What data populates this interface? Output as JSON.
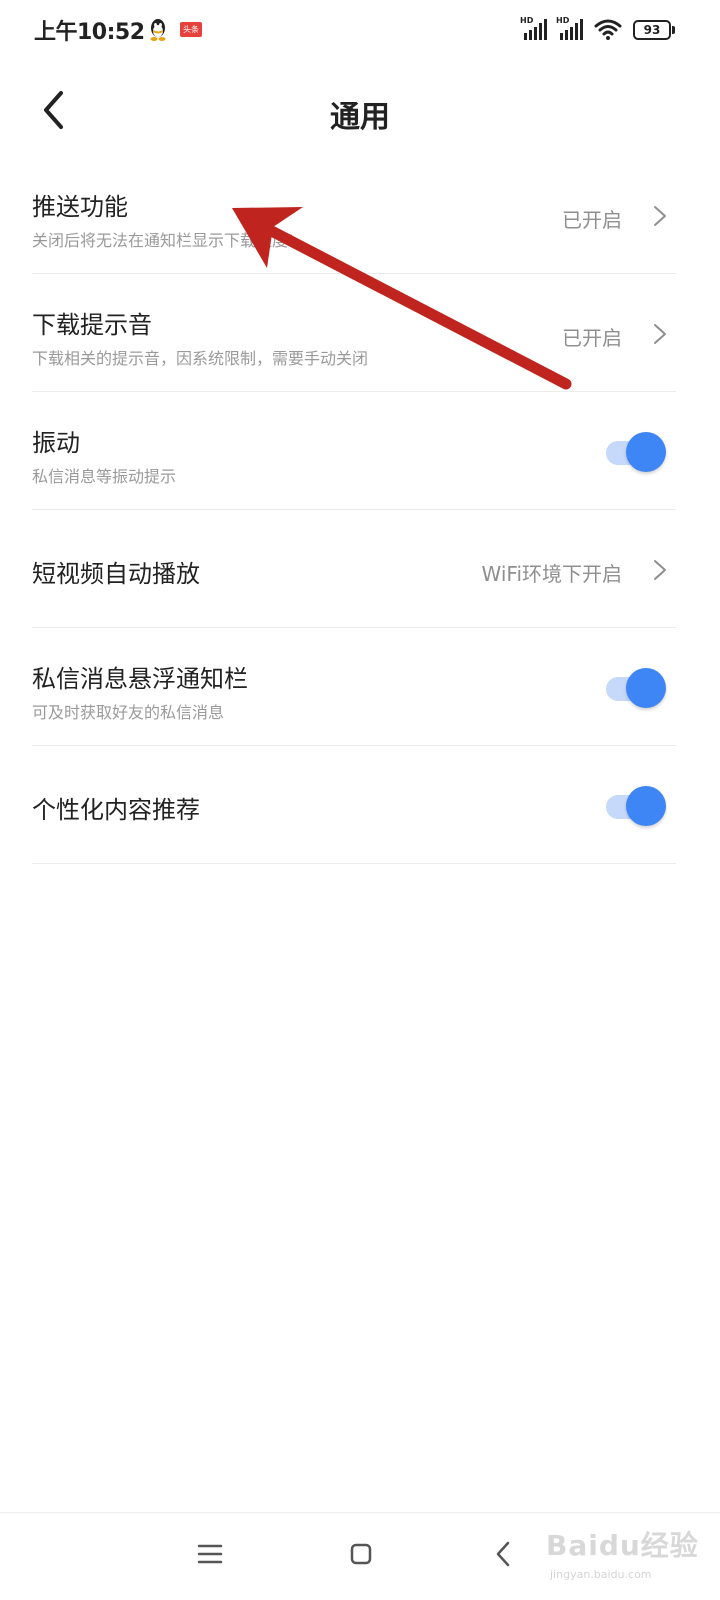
{
  "status_bar": {
    "time": "上午10:52",
    "notification_badge": "头条",
    "signal_labels": [
      "HD",
      "HD"
    ],
    "battery": "93",
    "icons": [
      "qq-icon",
      "toutiao-icon",
      "signal-icon",
      "signal-icon",
      "wifi-icon",
      "battery-icon"
    ]
  },
  "header": {
    "title": "通用",
    "back_icon": "back-arrow-icon"
  },
  "settings": [
    {
      "title": "推送功能",
      "subtitle": "关闭后将无法在通知栏显示下载进度!",
      "value": "已开启",
      "control": "chevron"
    },
    {
      "title": "下载提示音",
      "subtitle": "下载相关的提示音，因系统限制，需要手动关闭",
      "value": "已开启",
      "control": "chevron"
    },
    {
      "title": "振动",
      "subtitle": "私信消息等振动提示",
      "control": "toggle",
      "on": true
    },
    {
      "title": "短视频自动播放",
      "value": "WiFi环境下开启",
      "control": "chevron"
    },
    {
      "title": "私信消息悬浮通知栏",
      "subtitle": "可及时获取好友的私信消息",
      "control": "toggle",
      "on": true
    },
    {
      "title": "个性化内容推荐",
      "control": "toggle",
      "on": true
    }
  ],
  "nav_bar": {
    "icons": [
      "menu-icon",
      "home-icon",
      "back-icon"
    ]
  },
  "watermark": {
    "brand": "Baidu经验",
    "url": "jingyan.baidu.com"
  },
  "colors": {
    "accent": "#3e85f5",
    "toggle_track": "#c6d9fa",
    "annotation_arrow": "#c0241e",
    "text_primary": "#222222",
    "text_secondary": "#9a9a9a"
  }
}
